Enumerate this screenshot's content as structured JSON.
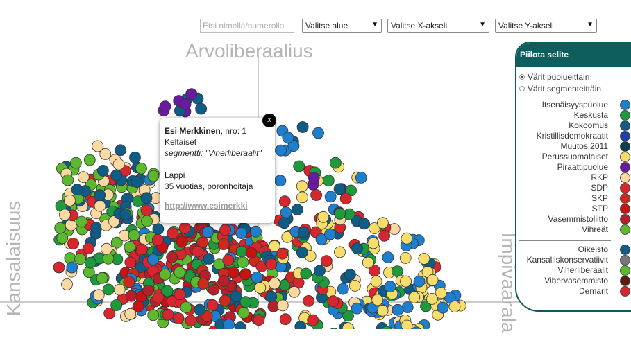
{
  "toolbar": {
    "search_placeholder": "Etsi nimellä/numerolla",
    "area_select": "Valitse alue",
    "x_select": "Valitse X-akseli",
    "y_select": "Valitse Y-akseli"
  },
  "axes": {
    "top": "Arvoliberaalius",
    "left": "Kansalaisuus",
    "right": "Impivaarala"
  },
  "popup": {
    "name": "Esi Merkkinen",
    "number": ", nro: 1",
    "party": "Keltaiset",
    "segment": "segmentti: \"Viherliberaalit\"",
    "region": "Lappi",
    "desc": "35 vuotias, poronhoitaja",
    "link": "http://www.esimerkki",
    "close": "x"
  },
  "legend": {
    "title": "Piilota selite",
    "radio_party": "Värit puolueittain",
    "radio_segment": "Värit segmenteittäin",
    "parties": [
      {
        "label": "Itsenäisyyspuolue",
        "color": "#1f7fcf"
      },
      {
        "label": "Keskusta",
        "color": "#1e9a3c"
      },
      {
        "label": "Kokoomus",
        "color": "#0f5d86"
      },
      {
        "label": "Kristillisdemokraatit",
        "color": "#1d3fa8"
      },
      {
        "label": "Muutos 2011",
        "color": "#0b3d4a"
      },
      {
        "label": "Perussuomalaiset",
        "color": "#f7dd6b"
      },
      {
        "label": "Piraattipuolue",
        "color": "#6a1aa0"
      },
      {
        "label": "RKP",
        "color": "#fbd9a0"
      },
      {
        "label": "SDP",
        "color": "#d8262f"
      },
      {
        "label": "SKP",
        "color": "#cc2a1e"
      },
      {
        "label": "STP",
        "color": "#c81313"
      },
      {
        "label": "Vasemmistoliitto",
        "color": "#b5202a"
      },
      {
        "label": "Vihreät",
        "color": "#5cb82d"
      }
    ],
    "segments": [
      {
        "label": "Oikeisto",
        "color": "#0f5d86"
      },
      {
        "label": "Kansalliskonservatiivit",
        "color": "#777777"
      },
      {
        "label": "Viherliberaalit",
        "color": "#5cb82d"
      },
      {
        "label": "Vihervasemmisto",
        "color": "#5a1c0e"
      },
      {
        "label": "Demarit",
        "color": "#d8262f"
      }
    ]
  }
}
